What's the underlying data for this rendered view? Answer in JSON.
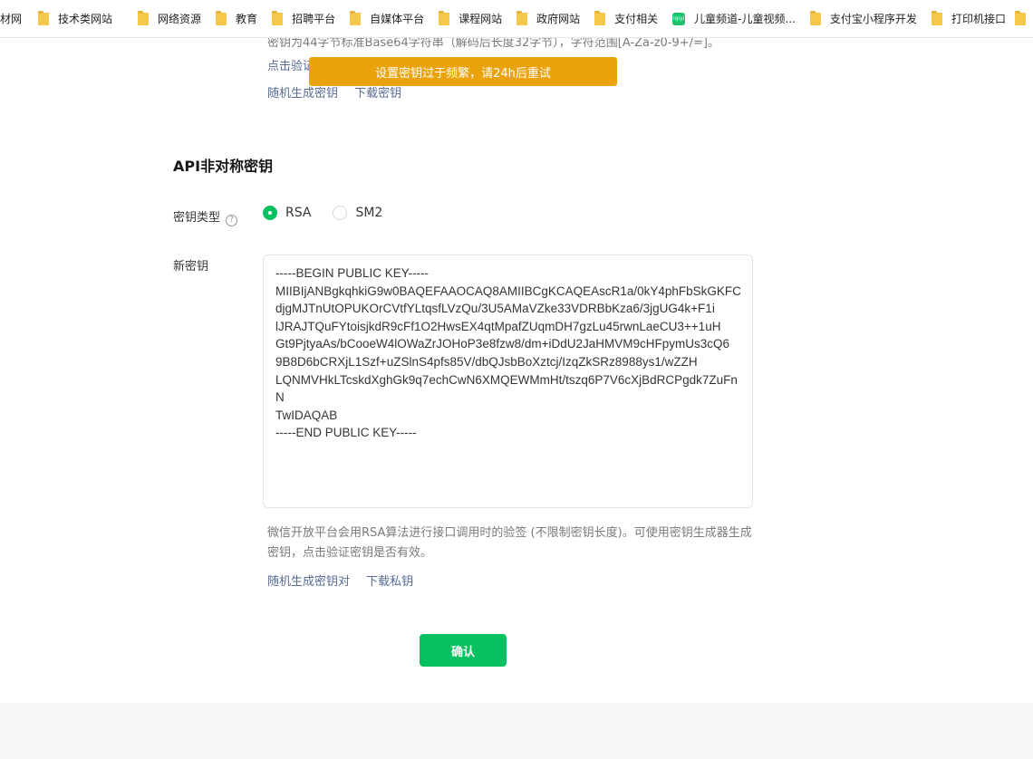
{
  "bookmarks": [
    {
      "label": "材网",
      "icon": "none"
    },
    {
      "label": "技术类网站",
      "icon": "folder-icon"
    },
    {
      "label": "网络资源",
      "icon": "folder-icon"
    },
    {
      "label": "教育",
      "icon": "folder-icon"
    },
    {
      "label": "招聘平台",
      "icon": "folder-icon"
    },
    {
      "label": "自媒体平台",
      "icon": "folder-icon"
    },
    {
      "label": "课程网站",
      "icon": "folder-icon"
    },
    {
      "label": "政府网站",
      "icon": "folder-icon"
    },
    {
      "label": "支付相关",
      "icon": "folder-icon"
    },
    {
      "label": "儿童频道-儿童视频...",
      "icon": "site-icon"
    },
    {
      "label": "支付宝小程序开发",
      "icon": "folder-icon"
    },
    {
      "label": "打印机接口",
      "icon": "folder-icon"
    }
  ],
  "symmetric": {
    "description": "密钥为44字节标准Base64字符串（解码后长度32字节），字符范围[A-Za-z0-9+/=]。",
    "verify_text": "点击验证",
    "generate_link": "随机生成密钥",
    "download_link": "下载密钥"
  },
  "toast": {
    "message": "设置密钥过于频繁，请24h后重试"
  },
  "asymmetric": {
    "title": "API非对称密钥",
    "key_type_label": "密钥类型",
    "key_types": [
      {
        "label": "RSA",
        "checked": true
      },
      {
        "label": "SM2",
        "checked": false
      }
    ],
    "new_key_label": "新密钥",
    "key_text": "-----BEGIN PUBLIC KEY-----\nMIIBIjANBgkqhkiG9w0BAQEFAAOCAQ8AMIIBCgKCAQEAscR1a/0kY4phFbSkGKFC\ndjgMJTnUtOPUKOrCVtfYLtqsfLVzQu/3U5AMaVZke33VDRBbKza6/3jgUG4k+F1i\nlJRAJTQuFYtoisjkdR9cFf1O2HwsEX4qtMpafZUqmDH7gzLu45rwnLaeCU3++1uH\nGt9PjtyaAs/bCooeW4lOWaZrJOHoP3e8fzw8/dm+iDdU2JaHMVM9cHFpymUs3cQ6\n9B8D6bCRXjL1Szf+uZSlnS4pfs85V/dbQJsbBoXztcj/IzqZkSRz8988ys1/wZZH\nLQNMVHkLTcskdXghGk9q7echCwN6XMQEWMmHt/tszq6P7V6cXjBdRCPgdk7ZuFnN\nTwIDAQAB\n-----END PUBLIC KEY-----",
    "description": "微信开放平台会用RSA算法进行接口调用时的验签 (不限制密钥长度)。可使用密钥生成器生成密钥，点击验证密钥是否有效。",
    "generate_link": "随机生成密钥对",
    "download_link": "下载私钥"
  },
  "confirm_label": "确认",
  "colors": {
    "accent": "#07c160",
    "toast": "#eba30d",
    "link": "#576b95"
  }
}
